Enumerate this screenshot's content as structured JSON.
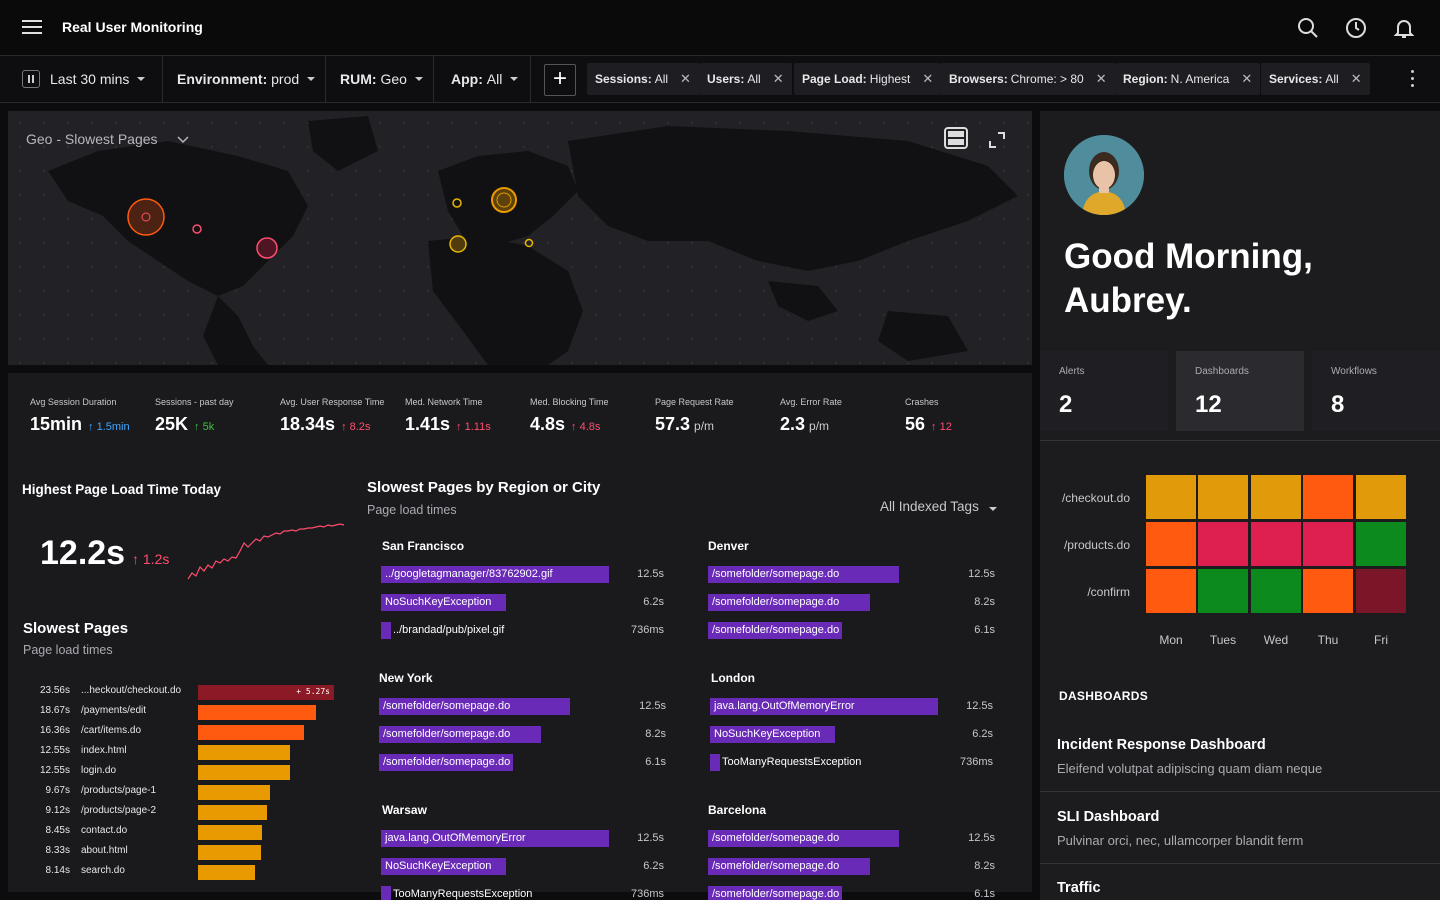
{
  "app": {
    "title": "Real User Monitoring"
  },
  "filters": {
    "time": "Last 30 mins",
    "environment": {
      "key": "Environment:",
      "value": "prod"
    },
    "rum": {
      "key": "RUM:",
      "value": "Geo"
    },
    "app": {
      "key": "App:",
      "value": "All"
    },
    "chips": [
      {
        "key": "Sessions:",
        "value": "All"
      },
      {
        "key": "Users:",
        "value": "All"
      },
      {
        "key": "Page Load:",
        "value": "Highest"
      },
      {
        "key": "Browsers:",
        "value": "Chrome: > 80"
      },
      {
        "key": "Region:",
        "value": "N. America"
      },
      {
        "key": "Services:",
        "value": "All"
      }
    ]
  },
  "map": {
    "title": "Geo - Slowest Pages"
  },
  "stats": [
    {
      "label": "Avg Session Duration",
      "value": "15min",
      "delta": "1.5min",
      "dir": "up-blue"
    },
    {
      "label": "Sessions - past day",
      "value": "25K",
      "delta": "5k",
      "dir": "up-green"
    },
    {
      "label": "Avg. User Response Time",
      "value": "18.34s",
      "delta": "8.2s",
      "dir": "up-red"
    },
    {
      "label": "Med. Network Time",
      "value": "1.41s",
      "delta": "1.11s",
      "dir": "up-red"
    },
    {
      "label": "Med. Blocking Time",
      "value": "4.8s",
      "delta": "4.8s",
      "dir": "up-red"
    },
    {
      "label": "Page Request Rate",
      "value": "57.3",
      "unit": "p/m"
    },
    {
      "label": "Avg. Error Rate",
      "value": "2.3",
      "unit": "p/m"
    },
    {
      "label": "Crashes",
      "value": "56",
      "delta": "12",
      "dir": "up-red"
    }
  ],
  "highest": {
    "title": "Highest Page Load Time Today",
    "value": "12.2s",
    "delta": "1.2s"
  },
  "slowest": {
    "title": "Slowest Pages",
    "subtitle": "Page load times",
    "rows": [
      {
        "time": "23.56s",
        "page": "...heckout/checkout.do",
        "pct": 1.0,
        "color": "#8b1a26",
        "delta": "+ 5.27s"
      },
      {
        "time": "18.67s",
        "page": "/payments/edit",
        "pct": 0.87,
        "color": "#ff5a10"
      },
      {
        "time": "16.36s",
        "page": "/cart/items.do",
        "pct": 0.78,
        "color": "#ff5a10"
      },
      {
        "time": "12.55s",
        "page": "index.html",
        "pct": 0.68,
        "color": "#e89a00"
      },
      {
        "time": "12.55s",
        "page": "login.do",
        "pct": 0.68,
        "color": "#e89a00"
      },
      {
        "time": "9.67s",
        "page": "/products/page-1",
        "pct": 0.53,
        "color": "#e89a00"
      },
      {
        "time": "9.12s",
        "page": "/products/page-2",
        "pct": 0.51,
        "color": "#e89a00"
      },
      {
        "time": "8.45s",
        "page": "contact.do",
        "pct": 0.47,
        "color": "#e89a00"
      },
      {
        "time": "8.33s",
        "page": "about.html",
        "pct": 0.46,
        "color": "#e89a00"
      },
      {
        "time": "8.14s",
        "page": "search.do",
        "pct": 0.42,
        "color": "#e89a00"
      }
    ]
  },
  "regions": {
    "title": "Slowest Pages by Region or City",
    "subtitle": "Page load times",
    "tags": "All Indexed Tags",
    "cities": [
      {
        "name": "San Francisco",
        "items": [
          {
            "page": "../googletagmanager/83762902.gif",
            "val": "12.5s",
            "pct": 1.0
          },
          {
            "page": "NoSuchKeyException",
            "val": "6.2s",
            "pct": 0.55
          },
          {
            "page": "../brandad/pub/pixel.gif",
            "val": "736ms",
            "pct": 0.05
          }
        ]
      },
      {
        "name": "Denver",
        "items": [
          {
            "page": "/somefolder/somepage.do",
            "val": "12.5s",
            "pct": 1.0
          },
          {
            "page": "/somefolder/somepage.do",
            "val": "8.2s",
            "pct": 0.85
          },
          {
            "page": "/somefolder/somepage.do",
            "val": "6.1s",
            "pct": 0.7
          }
        ]
      },
      {
        "name": "New York",
        "items": [
          {
            "page": "/somefolder/somepage.do",
            "val": "12.5s",
            "pct": 1.0
          },
          {
            "page": "/somefolder/somepage.do",
            "val": "8.2s",
            "pct": 0.85
          },
          {
            "page": "/somefolder/somepage.do",
            "val": "6.1s",
            "pct": 0.7
          }
        ]
      },
      {
        "name": "London",
        "items": [
          {
            "page": "java.lang.OutOfMemoryError",
            "val": "12.5s",
            "pct": 1.0
          },
          {
            "page": "NoSuchKeyException",
            "val": "6.2s",
            "pct": 0.55
          },
          {
            "page": "TooManyRequestsException",
            "val": "736ms",
            "pct": 0.05
          }
        ]
      },
      {
        "name": "Warsaw",
        "items": [
          {
            "page": "java.lang.OutOfMemoryError",
            "val": "12.5s",
            "pct": 1.0
          },
          {
            "page": "NoSuchKeyException",
            "val": "6.2s",
            "pct": 0.55
          },
          {
            "page": "TooManyRequestsException",
            "val": "736ms",
            "pct": 0.05
          }
        ]
      },
      {
        "name": "Barcelona",
        "items": [
          {
            "page": "/somefolder/somepage.do",
            "val": "12.5s",
            "pct": 1.0
          },
          {
            "page": "/somefolder/somepage.do",
            "val": "8.2s",
            "pct": 0.85
          },
          {
            "page": "/somefolder/somepage.do",
            "val": "6.1s",
            "pct": 0.7
          }
        ]
      }
    ]
  },
  "profile": {
    "greeting": "Good Morning,",
    "name": "Aubrey."
  },
  "kpis": [
    {
      "label": "Alerts",
      "value": "2"
    },
    {
      "label": "Dashboards",
      "value": "12"
    },
    {
      "label": "Workflows",
      "value": "8"
    }
  ],
  "heatmap": {
    "rows": [
      "/checkout.do",
      "/products.do",
      "/confirm"
    ],
    "days": [
      "Mon",
      "Tues",
      "Wed",
      "Thu",
      "Fri"
    ],
    "colors": [
      [
        "#e09a0a",
        "#e09a0a",
        "#e09a0a",
        "#ff5a10",
        "#e09a0a"
      ],
      [
        "#ff5a10",
        "#dd2050",
        "#dd2050",
        "#dd2050",
        "#0d8a1e"
      ],
      [
        "#ff5a10",
        "#0d8a1e",
        "#0d8a1e",
        "#ff5a10",
        "#7a1628"
      ]
    ]
  },
  "dashboards": {
    "heading": "DASHBOARDS",
    "items": [
      {
        "title": "Incident Response Dashboard",
        "desc": "Eleifend volutpat adipiscing quam diam neque"
      },
      {
        "title": "SLI Dashboard",
        "desc": "Pulvinar orci, nec, ullamcorper blandit ferm"
      },
      {
        "title": "Traffic",
        "desc": ""
      }
    ]
  },
  "colors": {
    "accent_purple": "#6a2ab8",
    "bg": "#0c0c0e",
    "panel": "#1a1a1d"
  }
}
